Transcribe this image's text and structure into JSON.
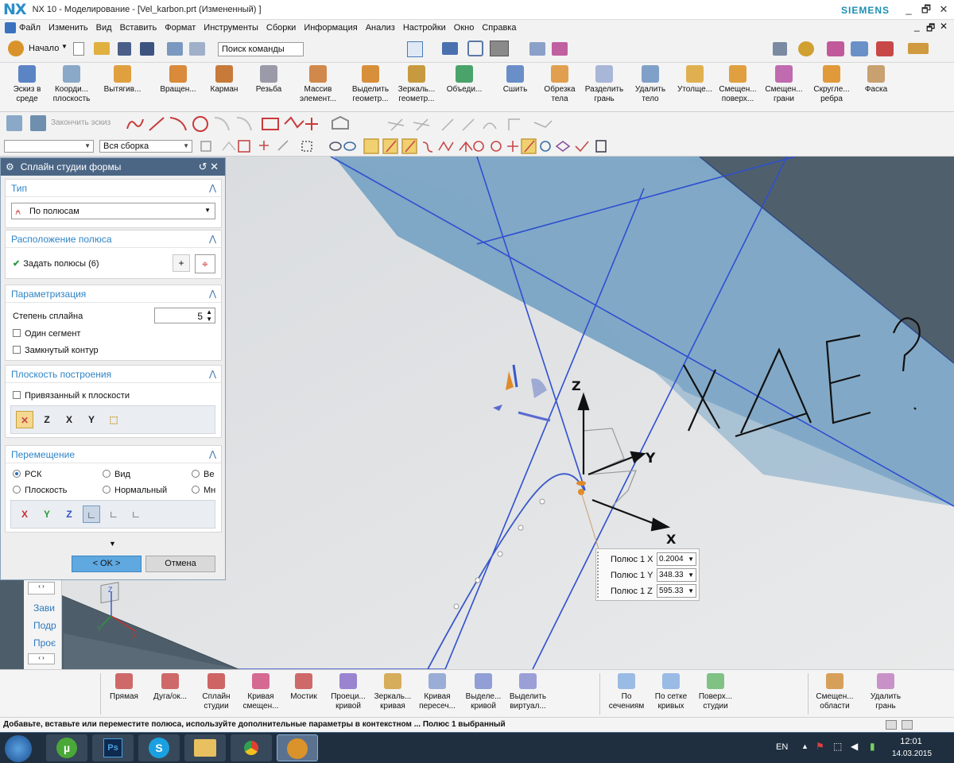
{
  "window": {
    "logo": "NX",
    "title": "NX 10 - Моделирование - [Vel_karbon.prt (Измененный) ]",
    "brand": "SIEMENS",
    "controls": [
      "_",
      "🗗",
      "✕"
    ]
  },
  "menu": {
    "items": [
      "Файл",
      "Изменить",
      "Вид",
      "Вставить",
      "Формат",
      "Инструменты",
      "Сборки",
      "Информация",
      "Анализ",
      "Настройки",
      "Окно",
      "Справка"
    ],
    "right_controls": [
      "_",
      "🗗",
      "✕"
    ]
  },
  "quick_access": {
    "start_label": "Начало",
    "search_placeholder": "Поиск команды"
  },
  "ribbon": {
    "buttons": [
      {
        "label": "Эскиз в среде",
        "color": "#5b84c4"
      },
      {
        "label": "Коорди... плоскость",
        "color": "#8aa8c8"
      },
      {
        "label": "Вытягив...",
        "color": "#e0a040"
      },
      {
        "label": "Вращен...",
        "color": "#d98a3a"
      },
      {
        "label": "Карман",
        "color": "#c77a3a"
      },
      {
        "label": "Резьба",
        "color": "#9a9aa8"
      },
      {
        "label": "Массив элемент...",
        "color": "#d0894a"
      },
      {
        "label": "Выделить геометр...",
        "color": "#d88f3a"
      },
      {
        "label": "Зеркаль... геометр...",
        "color": "#c89a40"
      },
      {
        "label": "Объеди...",
        "color": "#4aa36a"
      },
      {
        "label": "Сшить",
        "color": "#6a8ec8"
      },
      {
        "label": "Обрезка тела",
        "color": "#e0a050"
      },
      {
        "label": "Разделить грань",
        "color": "#a8b6d8"
      },
      {
        "label": "Удалить тело",
        "color": "#7fa0c8"
      },
      {
        "label": "Утолще...",
        "color": "#e0b050"
      },
      {
        "label": "Смещен... поверх...",
        "color": "#e0a040"
      },
      {
        "label": "Смещен... грани",
        "color": "#c06ab0"
      },
      {
        "label": "Скругле... ребра",
        "color": "#e09a3a"
      },
      {
        "label": "Фаска",
        "color": "#c9a070"
      }
    ]
  },
  "sketch_toolbar": {
    "finish_label": "Закончить эскиз"
  },
  "selection_bar": {
    "filter_value": "",
    "scope_value": "Вся сборка"
  },
  "dialog": {
    "title": "Сплайн студии формы",
    "sections": {
      "type": {
        "title": "Тип",
        "value": "По полюсам"
      },
      "pole_location": {
        "title": "Расположение полюса",
        "specify": "Задать полюсы (6)"
      },
      "parametrization": {
        "title": "Параметризация",
        "degree_label": "Степень сплайна",
        "degree_value": "5",
        "single_segment": "Один сегмент",
        "closed": "Замкнутый контур"
      },
      "plane": {
        "title": "Плоскость построения",
        "bound": "Привязанный к плоскости"
      },
      "move": {
        "title": "Перемещение",
        "radios": [
          {
            "label": "РСК",
            "checked": true
          },
          {
            "label": "Вид",
            "checked": false
          },
          {
            "label": "Ве",
            "checked": false
          },
          {
            "label": "Плоскость",
            "checked": false
          },
          {
            "label": "Нормальный",
            "checked": false
          },
          {
            "label": "Мн",
            "checked": false
          }
        ],
        "axes": [
          "X",
          "Y",
          "Z"
        ]
      }
    },
    "ok_label": "< OK >",
    "cancel_label": "Отмена"
  },
  "sidebar": {
    "items": [
      "Зави",
      "Подр",
      "Проє"
    ]
  },
  "viewport": {
    "axes": {
      "z": "Z",
      "y": "Y",
      "x": "X"
    },
    "handwriting": "ХДЕ?",
    "triad": {
      "x": "X",
      "y": "Y",
      "z": "Z"
    }
  },
  "pole_popup": {
    "rows": [
      {
        "label": "Полюс 1 X",
        "value": "0.2004"
      },
      {
        "label": "Полюс 1 Y",
        "value": "348.33"
      },
      {
        "label": "Полюс 1 Z",
        "value": "595.33"
      }
    ]
  },
  "bottom_toolbar": {
    "buttons": [
      {
        "label": "Прямая",
        "color": "#c85050"
      },
      {
        "label": "Дуга/ок...",
        "color": "#c85050"
      },
      {
        "label": "Сплайн студии",
        "color": "#c84a4a"
      },
      {
        "label": "Кривая смещен...",
        "color": "#d05080"
      },
      {
        "label": "Мостик",
        "color": "#c85050"
      },
      {
        "label": "Проеци... кривой",
        "color": "#8a70c8"
      },
      {
        "label": "Зеркаль... кривая",
        "color": "#d0a040"
      },
      {
        "label": "Кривая пересеч...",
        "color": "#8aa0d0"
      },
      {
        "label": "Выделе... кривой",
        "color": "#7f8fd0"
      },
      {
        "label": "Выделить виртуал...",
        "color": "#8a90d0"
      },
      {
        "label": "По сечениям",
        "color": "#8ab0e0"
      },
      {
        "label": "По сетке кривых",
        "color": "#8ab0e0"
      },
      {
        "label": "Поверх... студии",
        "color": "#6ab870"
      },
      {
        "label": "Смещен... области",
        "color": "#d09040"
      },
      {
        "label": "Удалить грань",
        "color": "#c080c0"
      }
    ]
  },
  "status": {
    "message": "Добавьте, вставьте или переместите полюса, используйте дополнительные параметры в контекстном ...   Полюс 1 выбранный"
  },
  "taskbar": {
    "lang": "EN",
    "time": "12:01",
    "date": "14.03.2015"
  },
  "colors": {
    "accent": "#2e84c6",
    "dialog_header": "#4b6685",
    "ok_button": "#5fa8e0",
    "plane_fill": "#7fa7c6",
    "curve": "#3a58c8"
  }
}
